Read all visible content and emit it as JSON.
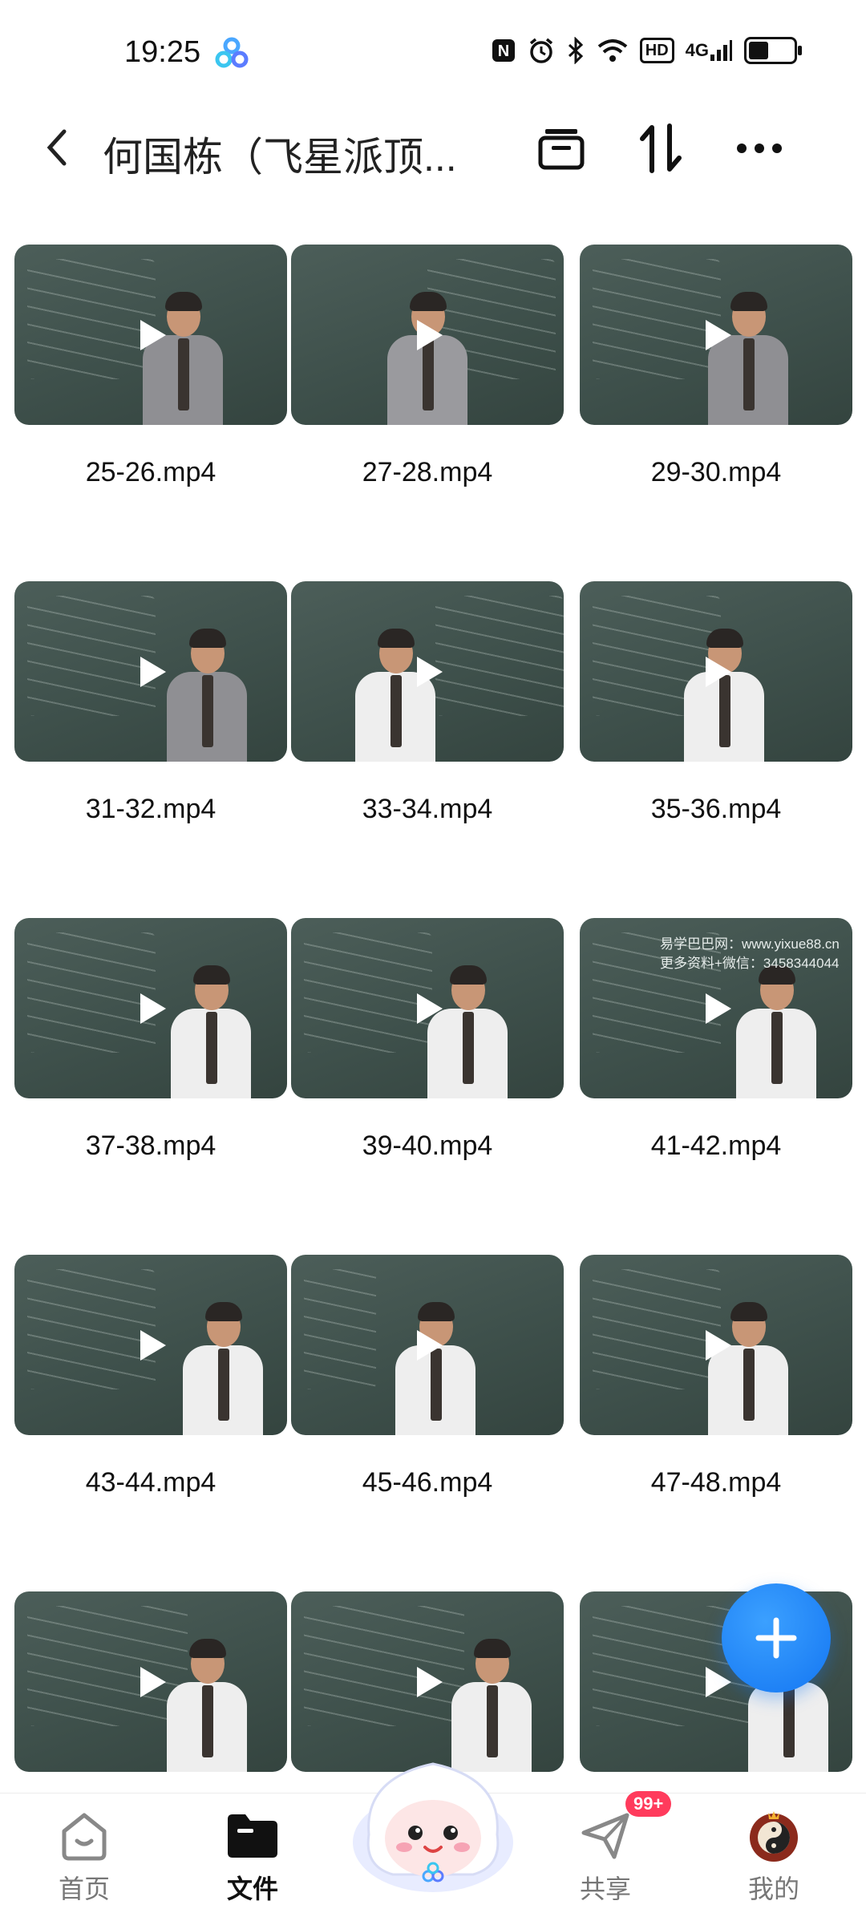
{
  "status_bar": {
    "time": "19:25",
    "nfc": "N",
    "hd": "HD",
    "signal": "4G"
  },
  "header": {
    "title": "何国栋（飞星派顶...",
    "icons": [
      "back-icon",
      "archive-icon",
      "sort-icon",
      "more-icon"
    ]
  },
  "files": [
    {
      "name": "25-26.mp4"
    },
    {
      "name": "27-28.mp4"
    },
    {
      "name": "29-30.mp4"
    },
    {
      "name": "31-32.mp4"
    },
    {
      "name": "33-34.mp4"
    },
    {
      "name": "35-36.mp4"
    },
    {
      "name": "37-38.mp4"
    },
    {
      "name": "39-40.mp4"
    },
    {
      "name": "41-42.mp4",
      "watermark": [
        "易学巴巴网：www.yixue88.cn",
        "更多资料+微信：3458344044"
      ]
    },
    {
      "name": "43-44.mp4"
    },
    {
      "name": "45-46.mp4"
    },
    {
      "name": "47-48.mp4"
    },
    {
      "name": ""
    },
    {
      "name": ""
    },
    {
      "name": ""
    }
  ],
  "nav": {
    "items": [
      {
        "label": "首页",
        "icon": "home-icon"
      },
      {
        "label": "文件",
        "icon": "folder-icon"
      },
      {
        "label": "共享",
        "icon": "share-icon"
      },
      {
        "label": "我的",
        "icon": "avatar"
      }
    ],
    "share_badge": "99+"
  },
  "colors": {
    "accent": "#1476f2",
    "badge": "#ff3b5c",
    "thumb_board": "#44574f"
  }
}
